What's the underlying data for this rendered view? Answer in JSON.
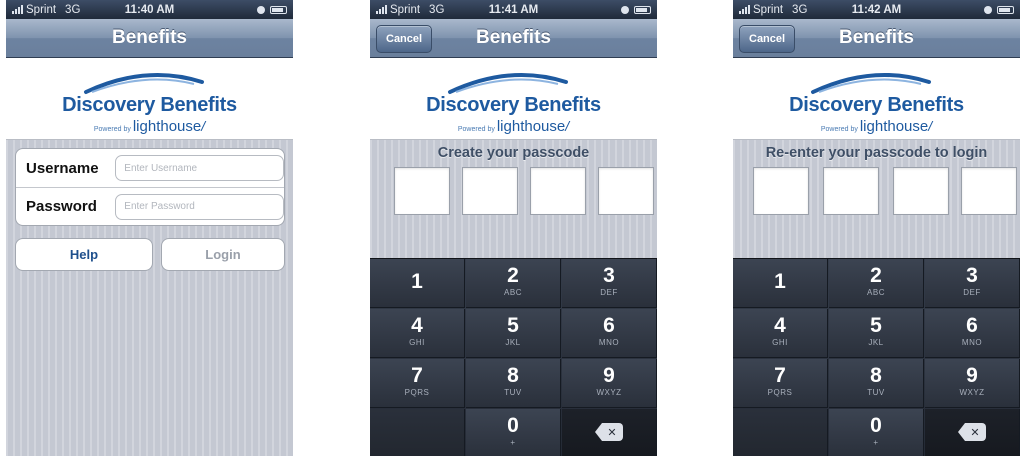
{
  "colors": {
    "brand": "#1e5aa0",
    "navbar": "#7f93ae",
    "keypad": "#2a303b"
  },
  "screens": [
    {
      "status": {
        "carrier": "Sprint",
        "network": "3G",
        "time": "11:40 AM"
      },
      "nav": {
        "title": "Benefits"
      },
      "logo": {
        "brand": "Discovery Benefits",
        "powered": "Powered by",
        "product": "lighthouse"
      },
      "login": {
        "username_label": "Username",
        "username_placeholder": "Enter Username",
        "password_label": "Password",
        "password_placeholder": "Enter Password",
        "help_label": "Help",
        "login_label": "Login"
      }
    },
    {
      "status": {
        "carrier": "Sprint",
        "network": "3G",
        "time": "11:41 AM"
      },
      "nav": {
        "title": "Benefits",
        "cancel": "Cancel"
      },
      "logo": {
        "brand": "Discovery Benefits",
        "powered": "Powered by",
        "product": "lighthouse"
      },
      "prompt": "Create your passcode"
    },
    {
      "status": {
        "carrier": "Sprint",
        "network": "3G",
        "time": "11:42 AM"
      },
      "nav": {
        "title": "Benefits",
        "cancel": "Cancel"
      },
      "logo": {
        "brand": "Discovery Benefits",
        "powered": "Powered by",
        "product": "lighthouse"
      },
      "prompt": "Re-enter your passcode to login"
    }
  ],
  "keypad": [
    {
      "num": "1",
      "sub": ""
    },
    {
      "num": "2",
      "sub": "ABC"
    },
    {
      "num": "3",
      "sub": "DEF"
    },
    {
      "num": "4",
      "sub": "GHI"
    },
    {
      "num": "5",
      "sub": "JKL"
    },
    {
      "num": "6",
      "sub": "MNO"
    },
    {
      "num": "7",
      "sub": "PQRS"
    },
    {
      "num": "8",
      "sub": "TUV"
    },
    {
      "num": "9",
      "sub": "WXYZ"
    },
    {
      "num": "0",
      "sub": "+"
    }
  ]
}
